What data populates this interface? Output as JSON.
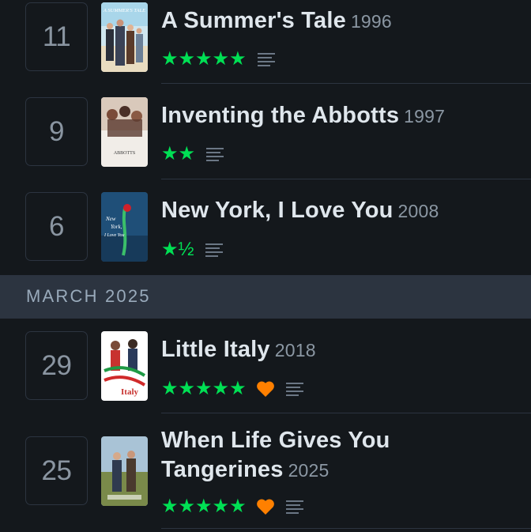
{
  "entries_before": [
    {
      "day": "11",
      "title": "A Summer's Tale",
      "year": "1996",
      "rating_stars": "★★★★★",
      "rating": 5,
      "liked": false,
      "has_review": true,
      "poster_text": "A SUMMER'S TALE"
    },
    {
      "day": "9",
      "title": "Inventing the Abbotts",
      "year": "1997",
      "rating_stars": "★★",
      "rating": 2,
      "liked": false,
      "has_review": true,
      "poster_text": "ABBOTTS"
    },
    {
      "day": "6",
      "title": "New York, I Love You",
      "year": "2008",
      "rating_stars": "★½",
      "rating": 1.5,
      "liked": false,
      "has_review": true,
      "poster_text": "New York, I Love You"
    }
  ],
  "month_header": "MARCH 2025",
  "entries_after": [
    {
      "day": "29",
      "title": "Little Italy",
      "year": "2018",
      "rating_stars": "★★★★★",
      "rating": 5,
      "liked": true,
      "has_review": true,
      "poster_text": "Little Italy"
    },
    {
      "day": "25",
      "title_line1": "When Life Gives You",
      "title_line2": "Tangerines",
      "year": "2025",
      "rating_stars": "★★★★★",
      "rating": 5,
      "liked": true,
      "has_review": true
    }
  ],
  "colors": {
    "background": "#14181c",
    "star": "#00e054",
    "heart": "#ff8000",
    "divider": "#2c3440",
    "month_bar": "#2c3440"
  },
  "icons": [
    "star-icon",
    "heart-icon",
    "review-lines-icon"
  ]
}
